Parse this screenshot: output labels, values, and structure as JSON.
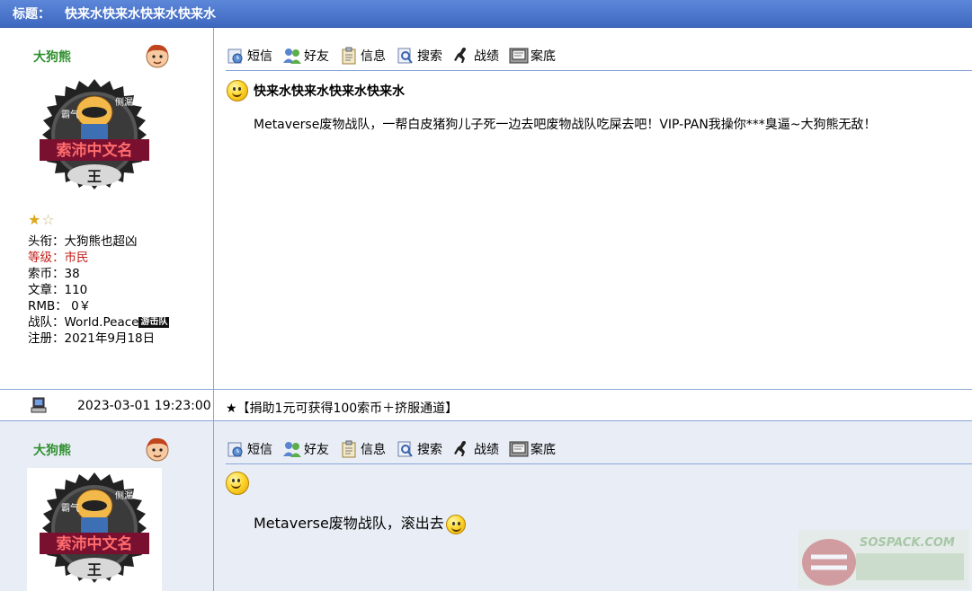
{
  "thread": {
    "title_label": "标题：",
    "title": "快来水快来水快来水快来水"
  },
  "toolbar": {
    "items": [
      {
        "label": "短信",
        "icon": "message-icon"
      },
      {
        "label": "好友",
        "icon": "friends-icon"
      },
      {
        "label": "信息",
        "icon": "info-icon"
      },
      {
        "label": "搜索",
        "icon": "search-icon"
      },
      {
        "label": "战绩",
        "icon": "record-icon"
      },
      {
        "label": "案底",
        "icon": "history-icon"
      }
    ]
  },
  "posts": [
    {
      "username": "大狗熊",
      "avatar_texts": {
        "top_left": "霸气",
        "top_right": "侧漏",
        "banner": "索沛中文名",
        "bottom": "王"
      },
      "rank_stars": {
        "full": 1,
        "empty": 1
      },
      "profile": {
        "title": "头衔：大狗熊也超凶",
        "level": "等级：市民",
        "coins": "索币：38",
        "articles": "文章：110",
        "rmb": "RMB： 0￥",
        "team_label": "战队：World.Peace",
        "team_badge": "游击队",
        "registered": "注册：2021年9月18日"
      },
      "post_title": "快来水快来水快来水快来水",
      "body": "Metaverse废物战队，一帮白皮猪狗儿子死一边去吧废物战队吃屎去吧！VIP-PAN我操你***臭逼~大狗熊无敌！",
      "timestamp": "2023-03-01 19:23:00",
      "footer_link": "★【捐助1元可获得100索币＋挤服通道】"
    },
    {
      "username": "大狗熊",
      "avatar_texts": {
        "top_left": "霸气",
        "top_right": "侧漏",
        "banner": "索沛中文名",
        "bottom": "王"
      },
      "body": "Metaverse废物战队，滚出去"
    }
  ],
  "watermark": {
    "text": "SOSPACK.COM"
  },
  "colors": {
    "header_blue": "#4a74cc",
    "username_green": "#2f8f2f",
    "level_red": "#c0201b",
    "border_blue": "#8aa6d8",
    "alt_row_bg": "#e9eef6"
  }
}
